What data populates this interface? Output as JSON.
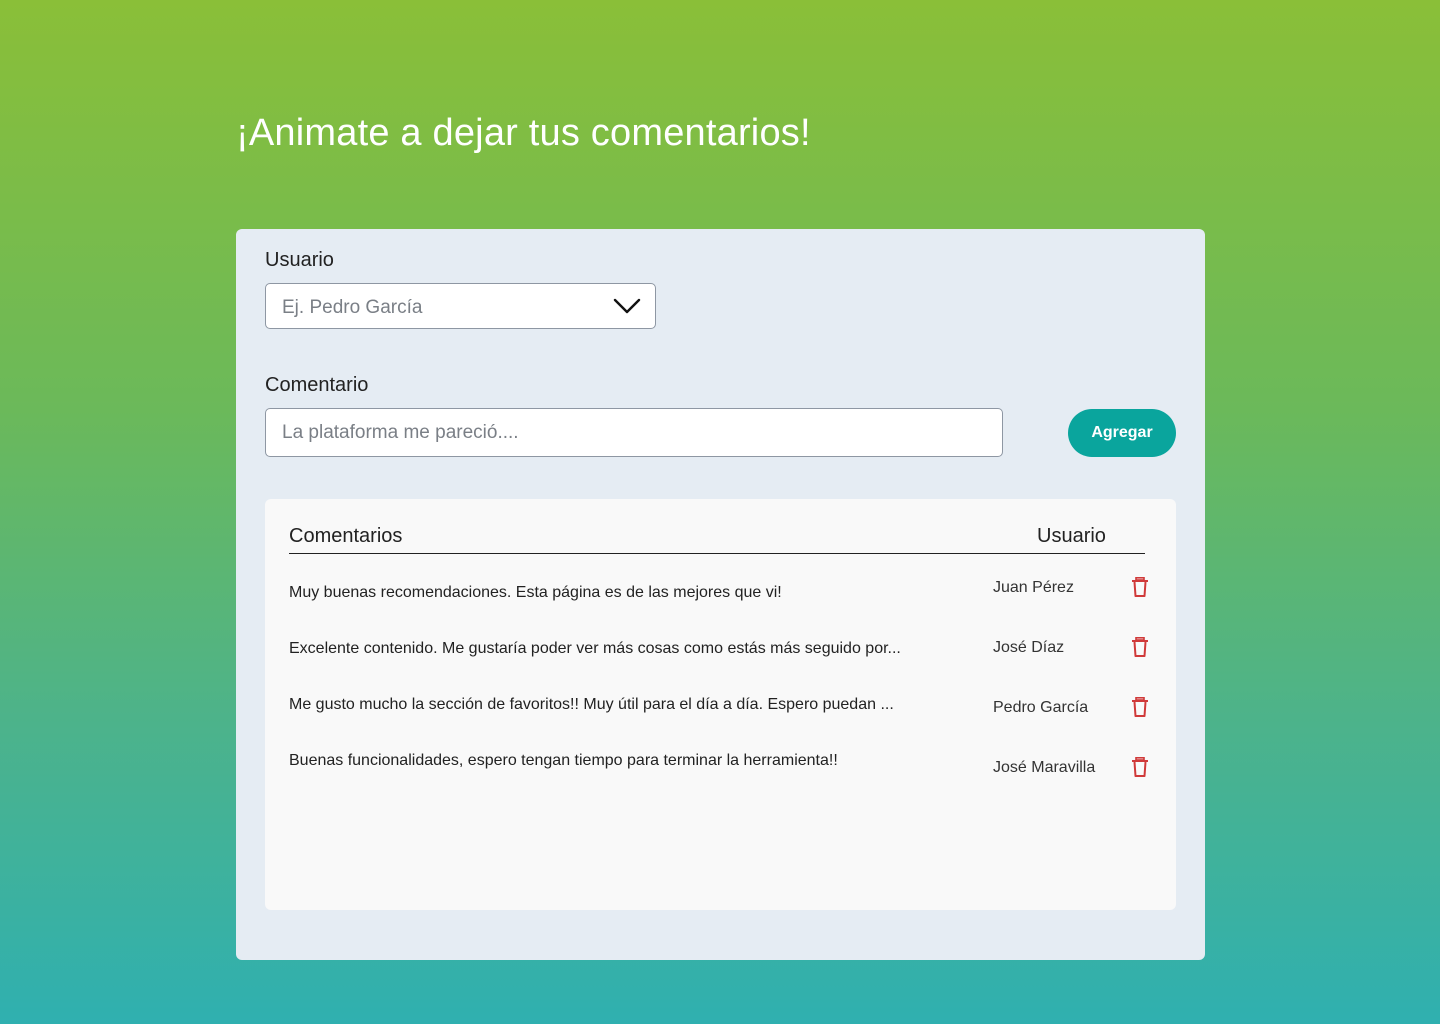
{
  "header": {
    "title": "¡Animate a dejar tus comentarios!"
  },
  "form": {
    "user_label": "Usuario",
    "user_placeholder": "Ej. Pedro García",
    "comment_label": "Comentario",
    "comment_placeholder": "La plataforma me pareció....",
    "add_button_label": "Agregar"
  },
  "table": {
    "col_comments": "Comentarios",
    "col_user": "Usuario",
    "rows": [
      {
        "comment": "Muy buenas recomendaciones. Esta página es de las mejores que vi!",
        "user": "Juan Pérez"
      },
      {
        "comment": "Excelente contenido. Me gustaría poder ver más cosas como estás más seguido por...",
        "user": "José Díaz"
      },
      {
        "comment": "Me gusto mucho la sección de favoritos!! Muy útil para el día a día. Espero puedan ...",
        "user": "Pedro García"
      },
      {
        "comment": "Buenas funcionalidades, espero tengan tiempo para terminar la herramienta!!",
        "user": "José Maravilla"
      }
    ]
  },
  "colors": {
    "accent": "#0aa59d",
    "delete": "#d03a3a",
    "gradient_top": "#8abf38",
    "gradient_bottom": "#2fb0b0"
  },
  "icons": {
    "select": "chevron-down-icon",
    "delete": "trash-icon"
  }
}
